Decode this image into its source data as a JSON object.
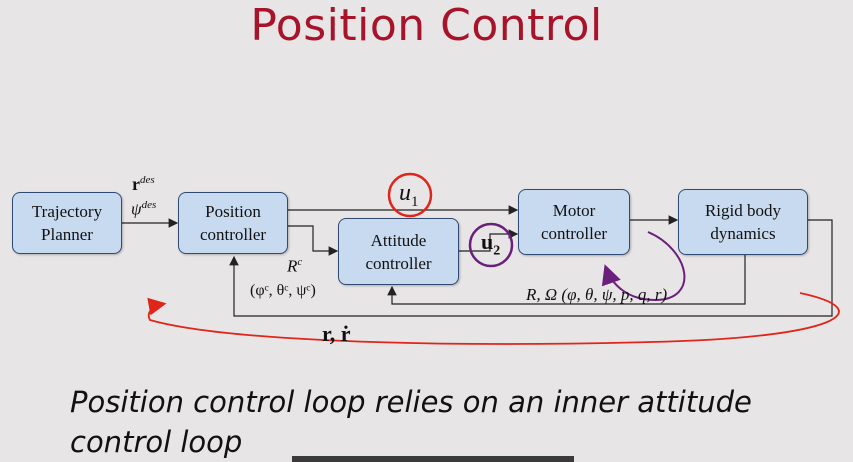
{
  "title": "Position Control",
  "blocks": {
    "trajectory_planner": {
      "line1": "Trajectory",
      "line2": "Planner"
    },
    "position_controller": {
      "line1": "Position",
      "line2": "controller"
    },
    "attitude_controller": {
      "line1": "Attitude",
      "line2": "controller"
    },
    "motor_controller": {
      "line1": "Motor",
      "line2": "controller"
    },
    "rigid_body_dynamics": {
      "line1": "Rigid body",
      "line2": "dynamics"
    }
  },
  "labels": {
    "r_des": "r",
    "r_des_sup": "des",
    "psi_des": "ψ",
    "psi_des_sup": "des",
    "u1": "u",
    "u1_sub": "1",
    "u2": "u",
    "u2_sub": "2",
    "r_c": "R",
    "r_c_sup": "c",
    "angles_c": "(φᶜ, θᶜ, ψᶜ)",
    "state_feedback": "R, Ω (φ, θ, ψ, p, q, r)",
    "position_feedback": "r, ṙ"
  },
  "caption": {
    "line1": "Position control loop relies on an inner attitude",
    "line2": "control loop"
  },
  "colors": {
    "title": "#a8132a",
    "block_fill": "#c8daf0",
    "block_border": "#2f4b73",
    "highlight_red": "#e0251b",
    "highlight_purple": "#6a1f7a"
  }
}
